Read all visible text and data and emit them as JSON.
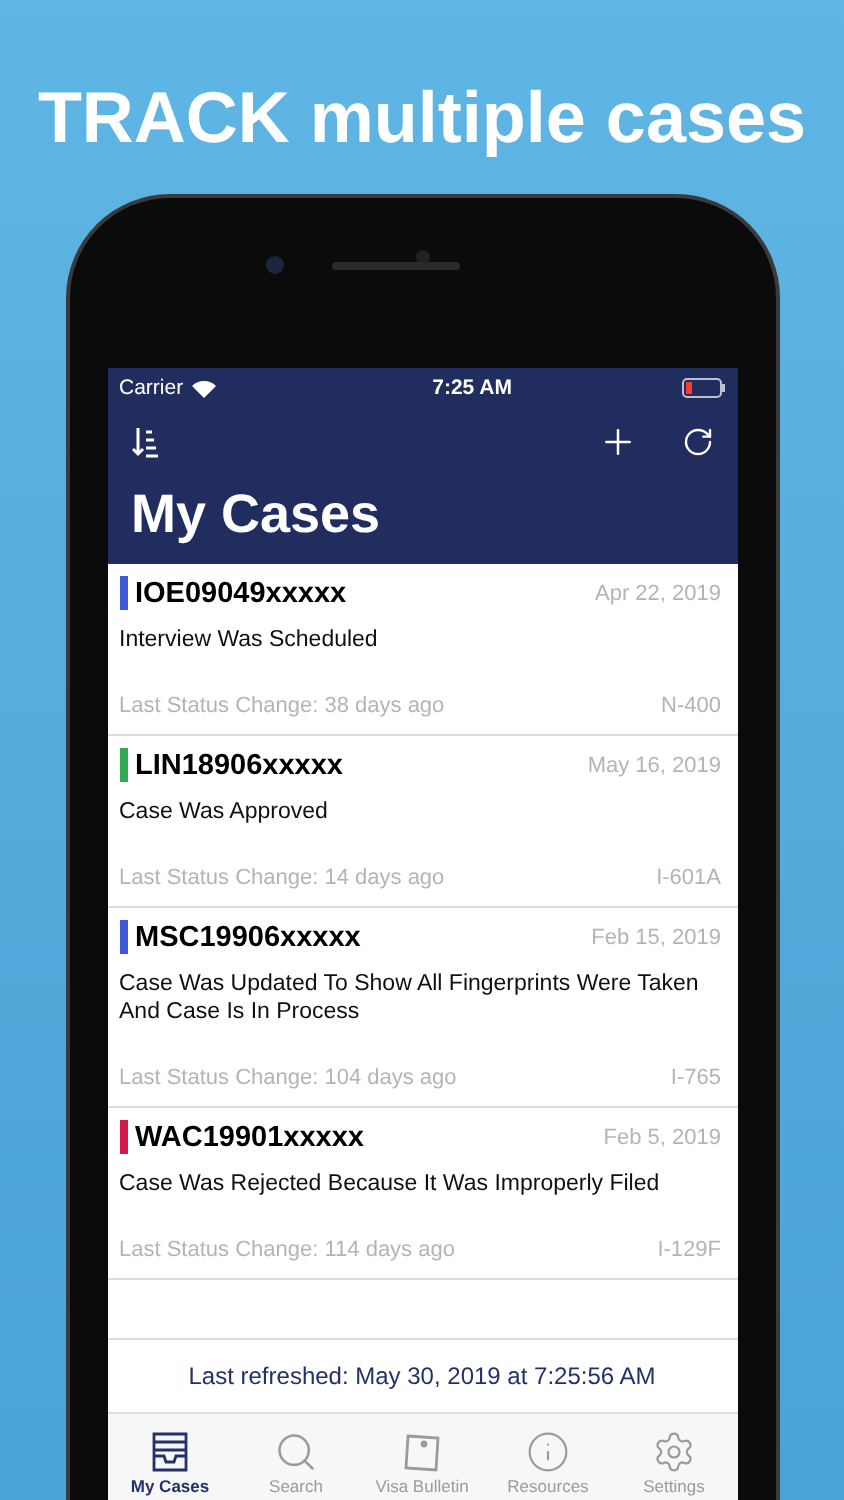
{
  "headline": "TRACK multiple cases",
  "status_bar": {
    "carrier": "Carrier",
    "time": "7:25 AM"
  },
  "nav": {
    "title": "My Cases"
  },
  "cases": [
    {
      "receipt": "IOE09049xxxxx",
      "color": "#3d5bd9",
      "date": "Apr 22, 2019",
      "status": "Interview Was Scheduled",
      "last_change": "Last Status Change: 38 days ago",
      "form": "N-400"
    },
    {
      "receipt": "LIN18906xxxxx",
      "color": "#2faa55",
      "date": "May 16, 2019",
      "status": "Case Was Approved",
      "last_change": "Last Status Change: 14 days ago",
      "form": "I-601A"
    },
    {
      "receipt": "MSC19906xxxxx",
      "color": "#3d5bd9",
      "date": "Feb 15, 2019",
      "status": "Case Was Updated To Show All Fingerprints Were Taken And Case Is In Process",
      "last_change": "Last Status Change: 104 days ago",
      "form": "I-765"
    },
    {
      "receipt": "WAC19901xxxxx",
      "color": "#d4184f",
      "date": "Feb 5, 2019",
      "status": "Case Was Rejected Because It Was Improperly Filed",
      "last_change": "Last Status Change: 114 days ago",
      "form": "I-129F"
    }
  ],
  "footer": "Last refreshed: May 30, 2019 at 7:25:56 AM",
  "tabs": [
    {
      "kind": "inbox",
      "label": "My Cases",
      "selected": true
    },
    {
      "kind": "search",
      "label": "Search",
      "selected": false
    },
    {
      "kind": "note",
      "label": "Visa Bulletin",
      "selected": false
    },
    {
      "kind": "info",
      "label": "Resources",
      "selected": false
    },
    {
      "kind": "settings",
      "label": "Settings",
      "selected": false
    }
  ]
}
